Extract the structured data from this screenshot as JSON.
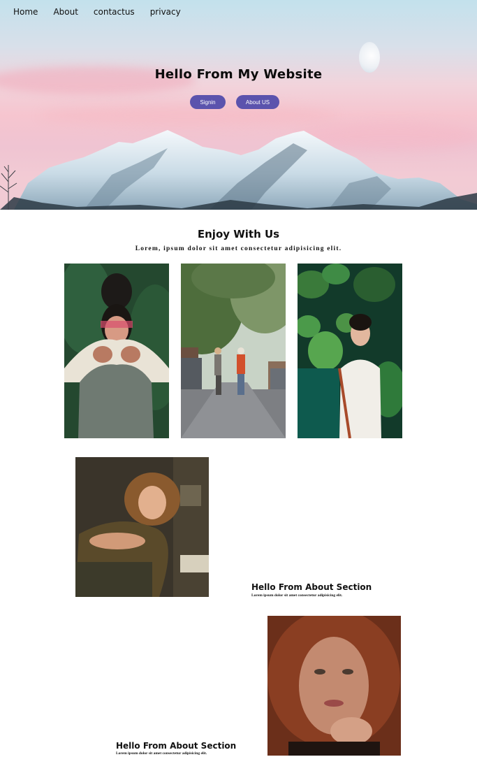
{
  "nav": {
    "items": [
      "Home",
      "About",
      "contactus",
      "privacy"
    ]
  },
  "hero": {
    "title": "Hello From My Website",
    "signin_label": "Signin",
    "about_label": "About US"
  },
  "enjoy": {
    "title": "Enjoy With Us",
    "subtitle": "Lorem, ipsum dolor sit amet consectetur adipisicing elit."
  },
  "about_sections": [
    {
      "title": "Hello From About Section",
      "subtitle": "Lorem ipsum dolor sit amet consectetur adipisicing elit."
    },
    {
      "title": "Hello From About Section",
      "subtitle": "Lorem ipsum dolor sit amet consectetur adipisicing elit."
    }
  ],
  "colors": {
    "button": "#5b53ad",
    "sky_top": "#c3e1ec",
    "sky_pink": "#f6c5cf"
  }
}
